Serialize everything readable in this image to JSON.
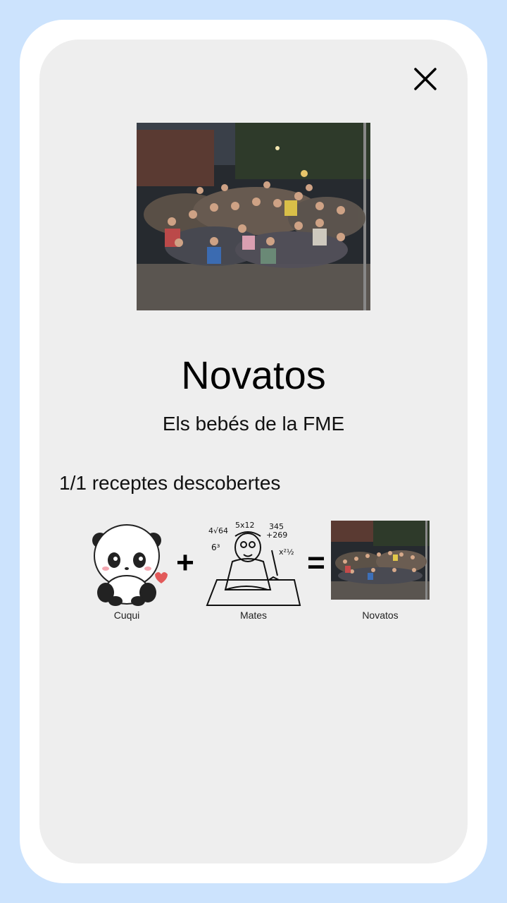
{
  "close": {
    "icon": "close-icon"
  },
  "group": {
    "title": "Novatos",
    "subtitle": "Els bebés de la FME"
  },
  "recipes": {
    "discovered_text": "1/1 receptes descobertes",
    "items": [
      {
        "label": "Cuqui",
        "icon": "panda-icon"
      },
      {
        "label": "Mates",
        "icon": "math-student-icon"
      },
      {
        "label": "Novatos",
        "icon": "group-photo-icon"
      }
    ],
    "operators": [
      "+",
      "="
    ]
  },
  "colors": {
    "background": "#cce3fd",
    "outer_card": "#ffffff",
    "inner_card": "#eeeeee"
  }
}
